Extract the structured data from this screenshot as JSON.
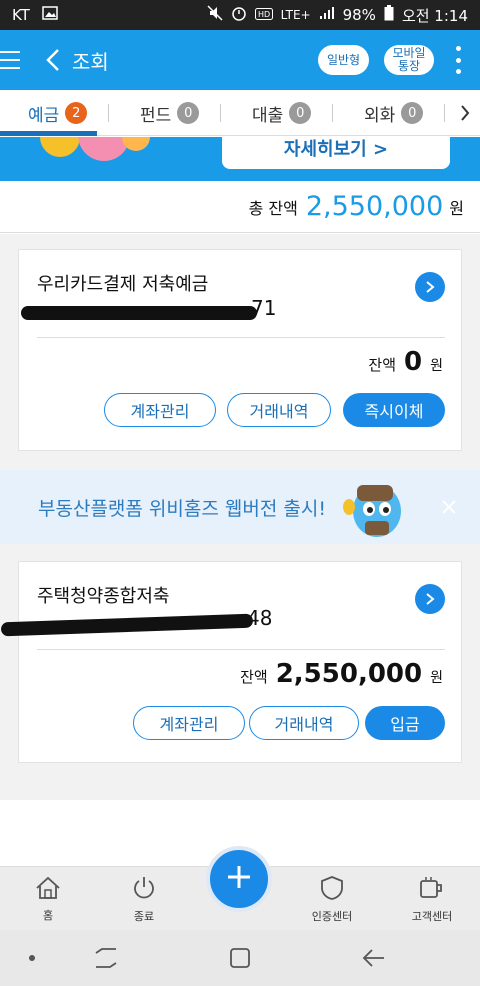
{
  "status_bar": {
    "carrier": "KT",
    "network": "LTE+",
    "battery": "98%",
    "time": "오전 1:14"
  },
  "header": {
    "title": "조회",
    "pill_general": "일반형",
    "pill_mobile_line1": "모바일",
    "pill_mobile_line2": "통장"
  },
  "tabs": [
    {
      "label": "예금",
      "count": "2"
    },
    {
      "label": "펀드",
      "count": "0"
    },
    {
      "label": "대출",
      "count": "0"
    },
    {
      "label": "외화",
      "count": "0"
    }
  ],
  "promo_top": {
    "button_label": "자세히보기 >"
  },
  "total": {
    "label": "총 잔액",
    "amount": "2,550,000",
    "unit": "원"
  },
  "accounts": [
    {
      "name": "우리카드결제 저축예금",
      "visible_suffix": "71",
      "balance_label": "잔액",
      "balance": "0",
      "unit": "원",
      "buttons": [
        "계좌관리",
        "거래내역",
        "즉시이체"
      ]
    },
    {
      "name": "주택청약종합저축",
      "visible_suffix": "48",
      "balance_label": "잔액",
      "balance": "2,550,000",
      "unit": "원",
      "buttons": [
        "계좌관리",
        "거래내역",
        "입금"
      ]
    }
  ],
  "ad_banner": {
    "text": "부동산플랫폼 위비홈즈 웹버전 출시!"
  },
  "bottom_nav": [
    {
      "label": "홈",
      "icon": "home-icon"
    },
    {
      "label": "종료",
      "icon": "power-icon"
    },
    {
      "label": "",
      "icon": "plus-icon"
    },
    {
      "label": "인증센터",
      "icon": "shield-icon"
    },
    {
      "label": "고객센터",
      "icon": "cup-icon"
    }
  ],
  "colors": {
    "primary": "#1a9be8",
    "accent_button": "#1a8ae6",
    "badge_active": "#e8641a",
    "badge_inactive": "#9a9a9a"
  }
}
